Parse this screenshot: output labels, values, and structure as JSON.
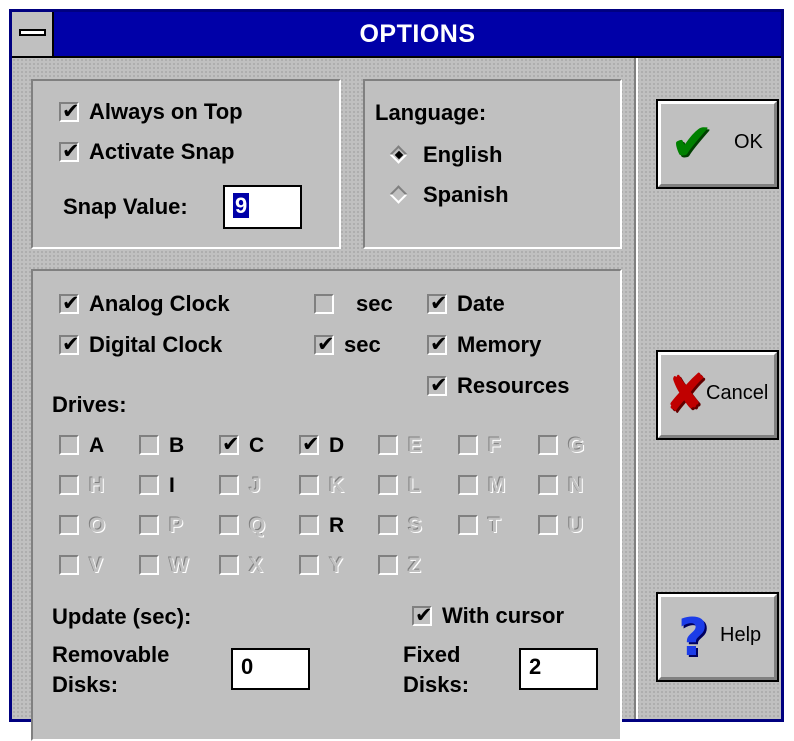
{
  "window": {
    "title": "OPTIONS"
  },
  "top_left": {
    "always_on_top": {
      "label": "Always on Top",
      "checked": true
    },
    "activate_snap": {
      "label": "Activate Snap",
      "checked": true
    },
    "snap_value_label": "Snap Value:",
    "snap_value": "9"
  },
  "language": {
    "label": "Language:",
    "options": [
      {
        "label": "English",
        "selected": true
      },
      {
        "label": "Spanish",
        "selected": false
      }
    ]
  },
  "clock": {
    "analog_clock": {
      "label": "Analog Clock",
      "checked": true
    },
    "analog_sec": {
      "label": "sec",
      "checked": false
    },
    "digital_clock": {
      "label": "Digital Clock",
      "checked": true
    },
    "digital_sec": {
      "label": "sec",
      "checked": true
    },
    "date": {
      "label": "Date",
      "checked": true
    },
    "memory": {
      "label": "Memory",
      "checked": true
    },
    "resources": {
      "label": "Resources",
      "checked": true
    }
  },
  "drives": {
    "label": "Drives:",
    "rows": [
      [
        {
          "letter": "A",
          "checked": false,
          "enabled": true
        },
        {
          "letter": "B",
          "checked": false,
          "enabled": true
        },
        {
          "letter": "C",
          "checked": true,
          "enabled": true
        },
        {
          "letter": "D",
          "checked": true,
          "enabled": true
        },
        {
          "letter": "E",
          "checked": false,
          "enabled": false
        },
        {
          "letter": "F",
          "checked": false,
          "enabled": false
        },
        {
          "letter": "G",
          "checked": false,
          "enabled": false
        }
      ],
      [
        {
          "letter": "H",
          "checked": false,
          "enabled": false
        },
        {
          "letter": "I",
          "checked": false,
          "enabled": true
        },
        {
          "letter": "J",
          "checked": false,
          "enabled": false
        },
        {
          "letter": "K",
          "checked": false,
          "enabled": false
        },
        {
          "letter": "L",
          "checked": false,
          "enabled": false
        },
        {
          "letter": "M",
          "checked": false,
          "enabled": false
        },
        {
          "letter": "N",
          "checked": false,
          "enabled": false
        }
      ],
      [
        {
          "letter": "O",
          "checked": false,
          "enabled": false
        },
        {
          "letter": "P",
          "checked": false,
          "enabled": false
        },
        {
          "letter": "Q",
          "checked": false,
          "enabled": false
        },
        {
          "letter": "R",
          "checked": false,
          "enabled": true
        },
        {
          "letter": "S",
          "checked": false,
          "enabled": false
        },
        {
          "letter": "T",
          "checked": false,
          "enabled": false
        },
        {
          "letter": "U",
          "checked": false,
          "enabled": false
        }
      ],
      [
        {
          "letter": "V",
          "checked": false,
          "enabled": false
        },
        {
          "letter": "W",
          "checked": false,
          "enabled": false
        },
        {
          "letter": "X",
          "checked": false,
          "enabled": false
        },
        {
          "letter": "Y",
          "checked": false,
          "enabled": false
        },
        {
          "letter": "Z",
          "checked": false,
          "enabled": false
        }
      ]
    ]
  },
  "update": {
    "label": "Update (sec):",
    "with_cursor": {
      "label": "With cursor",
      "checked": true
    },
    "removable_label_1": "Removable",
    "removable_label_2": "Disks:",
    "removable_value": "0",
    "fixed_label_1": "Fixed",
    "fixed_label_2": "Disks:",
    "fixed_value": "2"
  },
  "buttons": {
    "ok": {
      "label": "OK",
      "icon": "checkmark-icon",
      "color": "#008000"
    },
    "cancel": {
      "label": "Cancel",
      "icon": "red-x-icon",
      "color": "#c00000"
    },
    "help": {
      "label": "Help",
      "icon": "question-mark-icon",
      "color": "#0000c0"
    }
  }
}
